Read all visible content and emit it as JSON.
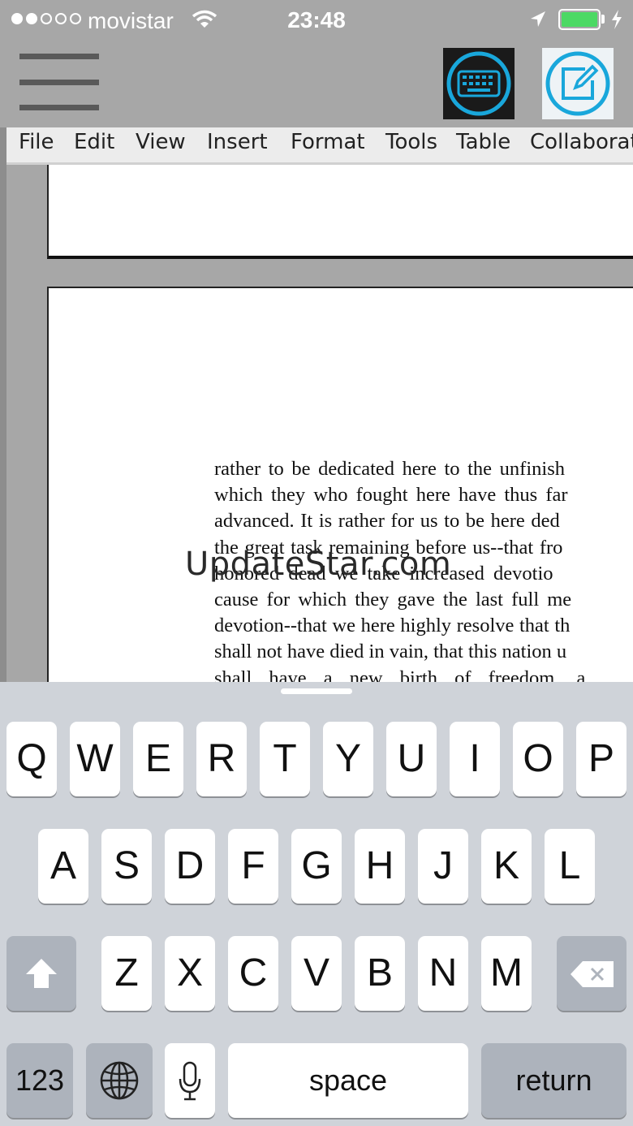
{
  "status_bar": {
    "carrier": "movistar",
    "time": "23:48",
    "signal_bars_filled": 2,
    "signal_bars_total": 5,
    "battery_color": "#4cd964"
  },
  "toolbar": {
    "menu_icon": "hamburger-icon",
    "keyboard_icon": "keyboard-icon",
    "edit_icon": "edit-icon"
  },
  "menubar": {
    "items": [
      "File",
      "Edit",
      "View",
      "Insert",
      "Format",
      "Tools",
      "Table",
      "Collaborat"
    ]
  },
  "document": {
    "lines": [
      "rather to be dedicated here to the unfinish",
      "which they who fought here have thus far",
      "advanced. It is rather for us to be here ded",
      "the great task remaining before us--that fro",
      "honored dead we take increased devotio",
      "cause for which they gave the last full me",
      "devotion--that we here highly resolve that th",
      "shall not have died in vain, that this nation u",
      "shall have a new birth of freedom, a"
    ]
  },
  "watermark": "UpdateStar.com",
  "keyboard": {
    "row1": [
      "Q",
      "W",
      "E",
      "R",
      "T",
      "Y",
      "U",
      "I",
      "O",
      "P"
    ],
    "row2": [
      "A",
      "S",
      "D",
      "F",
      "G",
      "H",
      "J",
      "K",
      "L"
    ],
    "row3": [
      "Z",
      "X",
      "C",
      "V",
      "B",
      "N",
      "M"
    ],
    "numbers_label": "123",
    "space_label": "space",
    "return_label": "return",
    "icons": [
      "shift-icon",
      "delete-icon",
      "globe-icon",
      "microphone-icon"
    ]
  }
}
